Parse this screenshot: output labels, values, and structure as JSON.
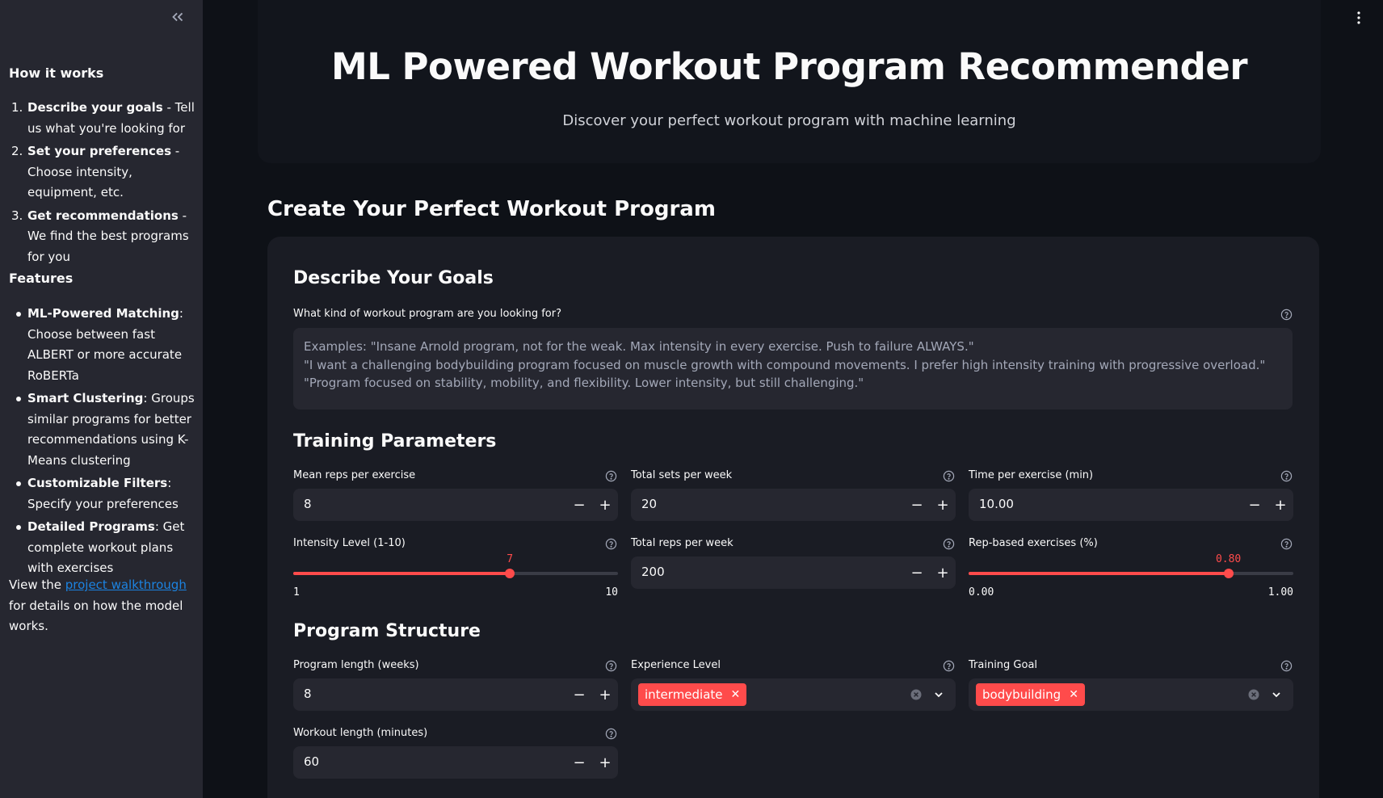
{
  "sidebar": {
    "how_title": "How it works",
    "steps": [
      {
        "num": "1.",
        "bold": "Describe your goals",
        "text": " - Tell us what you're looking for"
      },
      {
        "num": "2.",
        "bold": "Set your preferences",
        "text": " - Choose intensity, equipment, etc."
      },
      {
        "num": "3.",
        "bold": "Get recommendations",
        "text": " - We find the best programs for you"
      }
    ],
    "features_title": "Features",
    "features": [
      {
        "bold": "ML-Powered Matching",
        "text": ": Choose between fast ALBERT or more accurate RoBERTa"
      },
      {
        "bold": "Smart Clustering",
        "text": ": Groups similar programs for better recommendations using K-Means clustering"
      },
      {
        "bold": "Customizable Filters",
        "text": ": Specify your preferences"
      },
      {
        "bold": "Detailed Programs",
        "text": ": Get complete workout plans with exercises"
      }
    ],
    "footer_pre": "View the ",
    "footer_link": "project walkthrough",
    "footer_post": " for details on how the model works."
  },
  "header": {
    "title": "ML Powered Workout Program Recommender",
    "subtitle": "Discover your perfect workout program with machine learning"
  },
  "main": {
    "section_title": "Create Your Perfect Workout Program",
    "goals": {
      "title": "Describe Your Goals",
      "label": "What kind of workout program are you looking for?",
      "placeholder": "Examples: \"Insane Arnold program, not for the weak. Max intensity in every exercise. Push to failure ALWAYS.\"\n\"I want a challenging bodybuilding program focused on muscle growth with compound movements. I prefer high intensity training with progressive overload.\"\n\"Program focused on stability, mobility, and flexibility. Lower intensity, but still challenging.\""
    },
    "training": {
      "title": "Training Parameters",
      "mean_reps": {
        "label": "Mean reps per exercise",
        "value": "8"
      },
      "total_sets": {
        "label": "Total sets per week",
        "value": "20"
      },
      "time_per_ex": {
        "label": "Time per exercise (min)",
        "value": "10.00"
      },
      "intensity": {
        "label": "Intensity Level (1-10)",
        "value": "7",
        "min": "1",
        "max": "10",
        "fraction": 0.667
      },
      "total_reps": {
        "label": "Total reps per week",
        "value": "200"
      },
      "rep_based": {
        "label": "Rep-based exercises (%)",
        "value": "0.80",
        "min": "0.00",
        "max": "1.00",
        "fraction": 0.8
      }
    },
    "structure": {
      "title": "Program Structure",
      "program_length": {
        "label": "Program length (weeks)",
        "value": "8"
      },
      "experience": {
        "label": "Experience Level",
        "tag": "intermediate"
      },
      "goal": {
        "label": "Training Goal",
        "tag": "bodybuilding"
      },
      "workout_length": {
        "label": "Workout length (minutes)",
        "value": "60"
      }
    }
  },
  "colors": {
    "accent": "#ff4b4b",
    "link": "#1c83e1",
    "bg": "#0e1117",
    "sidebar": "#262730"
  }
}
